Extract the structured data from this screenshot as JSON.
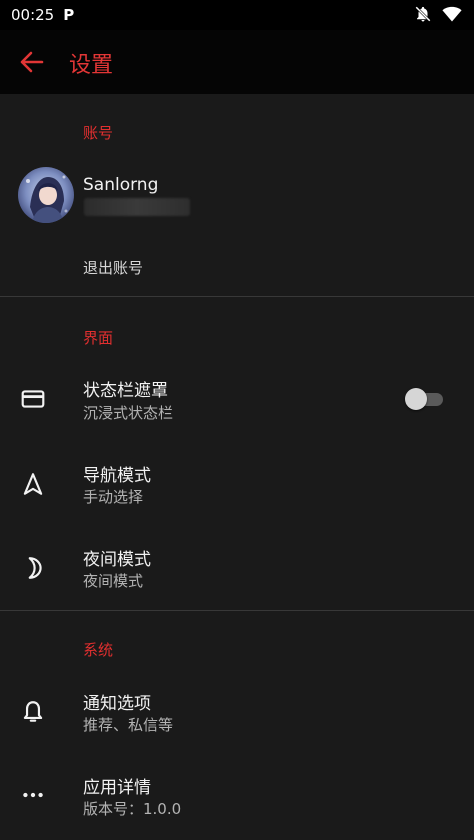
{
  "status_bar": {
    "time": "00:25",
    "app_indicator": "P",
    "icons": [
      "notifications-off-icon",
      "wifi-icon"
    ]
  },
  "app_bar": {
    "back_icon": "arrow-left-icon",
    "title": "设置"
  },
  "colors": {
    "accent": "#e23636",
    "background": "#1a1a1a",
    "app_bar": "#050505"
  },
  "sections": {
    "account": {
      "header": "账号",
      "user_name": "Sanlorng",
      "logout_label": "退出账号"
    },
    "interface": {
      "header": "界面",
      "status_bar_mask": {
        "title": "状态栏遮罩",
        "subtitle": "沉浸式状态栏",
        "icon": "card-icon",
        "enabled": false
      },
      "navigation_mode": {
        "title": "导航模式",
        "subtitle": "手动选择",
        "icon": "navigation-icon"
      },
      "night_mode": {
        "title": "夜间模式",
        "subtitle": "夜间模式",
        "icon": "moon-icon"
      }
    },
    "system": {
      "header": "系统",
      "notifications": {
        "title": "通知选项",
        "subtitle": "推荐、私信等",
        "icon": "bell-icon"
      },
      "app_details": {
        "title": "应用详情",
        "subtitle": "版本号：1.0.0",
        "icon": "more-horizontal-icon"
      }
    }
  }
}
